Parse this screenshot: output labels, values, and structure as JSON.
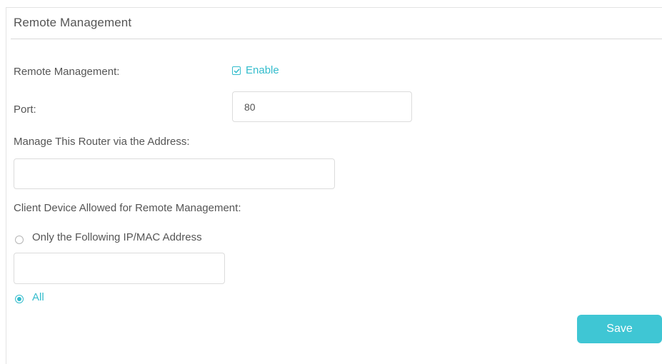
{
  "section": {
    "title": "Remote Management"
  },
  "remote_management": {
    "label": "Remote Management:",
    "checkbox_checked": true,
    "enable_label": "Enable"
  },
  "port": {
    "label": "Port:",
    "value": "80"
  },
  "address": {
    "label": "Manage This Router via the Address:",
    "value": ""
  },
  "client_device": {
    "label": "Client Device Allowed for Remote Management:",
    "options": [
      {
        "label": "Only the Following IP/MAC Address",
        "selected": false
      },
      {
        "label": "All",
        "selected": true
      }
    ],
    "ip_mac_value": ""
  },
  "actions": {
    "save_label": "Save"
  },
  "colors": {
    "accent": "#33bccc",
    "button": "#3fc6d4",
    "text": "#555555",
    "border": "#dcdcdc"
  }
}
